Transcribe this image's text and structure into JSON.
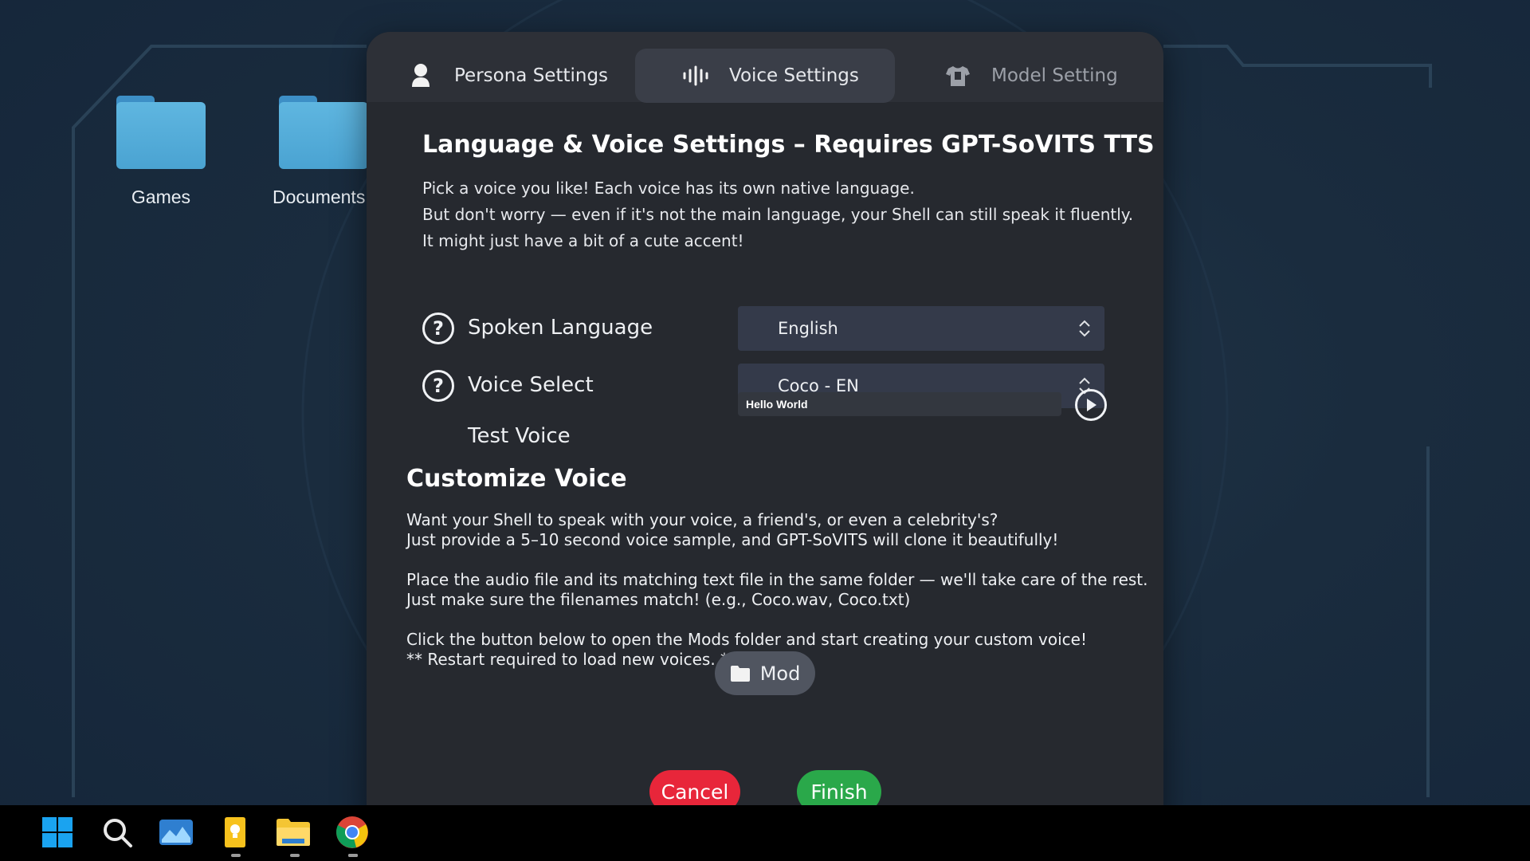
{
  "desktop": {
    "icons": [
      {
        "label": "Games"
      },
      {
        "label": "Documents"
      }
    ]
  },
  "dialog": {
    "tabs": [
      {
        "label": "Persona Settings",
        "icon": "person-icon",
        "active": false
      },
      {
        "label": "Voice Settings",
        "icon": "audio-wave-icon",
        "active": true
      },
      {
        "label": "Model Setting",
        "icon": "shirt-icon",
        "active": false
      }
    ],
    "title": "Language & Voice Settings – Requires GPT-SoVITS TTS",
    "intro": [
      "Pick a voice you like! Each voice has its own native language.",
      "But don't worry — even if it's not the main language, your Shell can still speak it fluently.",
      "It might just have a bit of a cute accent!"
    ],
    "spoken_language": {
      "label": "Spoken Language",
      "value": "English"
    },
    "voice_select": {
      "label": "Voice Select",
      "value": "Coco - EN"
    },
    "test_voice": {
      "label": "Test Voice",
      "value": "Hello World"
    },
    "customize": {
      "title": "Customize Voice",
      "para1": [
        "Want your Shell to speak with your voice, a friend's, or even a celebrity's?",
        "Just provide a 5–10 second voice sample, and GPT-SoVITS will clone it beautifully!"
      ],
      "para2": [
        "Place the audio file and its matching text file in the same folder — we'll take care of the rest.",
        "Just make sure the filenames match! (e.g., Coco.wav, Coco.txt)"
      ],
      "para3": [
        "Click the button below to open the Mods folder and start creating your custom voice!",
        "** Restart required to load new voices. **"
      ],
      "mod_button": "Mod"
    },
    "cancel_label": "Cancel",
    "finish_label": "Finish"
  },
  "taskbar": {
    "icons": [
      "windows-start-icon",
      "search-icon",
      "photos-icon",
      "notes-icon",
      "file-explorer-icon",
      "chrome-icon"
    ]
  },
  "colors": {
    "dialog_bg": "#26292f",
    "active_tab": "#3a3e48",
    "select_bg": "#343a4a",
    "cancel": "#e8263a",
    "finish": "#2aa84a"
  }
}
